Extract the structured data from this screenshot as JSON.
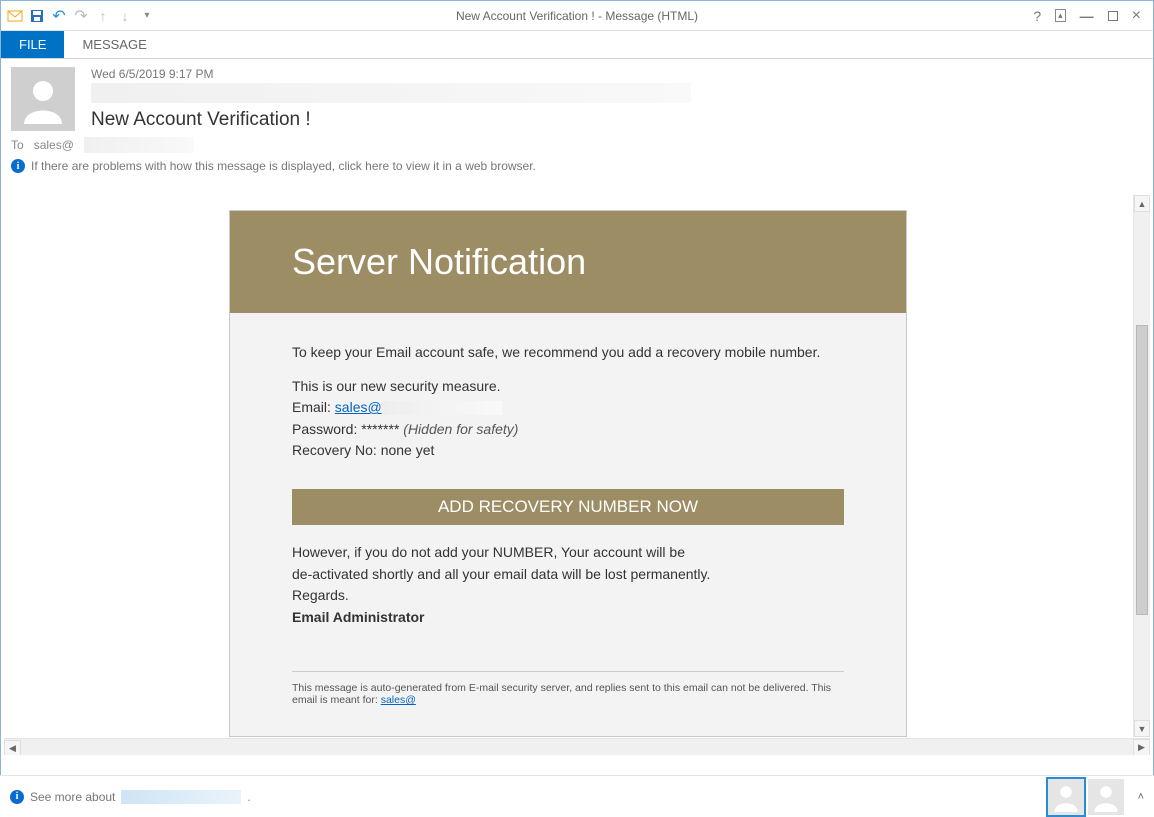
{
  "window": {
    "title": "New Account Verification ! - Message (HTML)"
  },
  "ribbon": {
    "file": "FILE",
    "message": "MESSAGE"
  },
  "header": {
    "date": "Wed 6/5/2019 9:17 PM",
    "subject": "New Account Verification !",
    "to_label": "To",
    "to_value": "sales@",
    "info_notice": "If there are problems with how this message is displayed, click here to view it in a web browser."
  },
  "email": {
    "banner": "Server Notification",
    "para1": "To keep your Email account safe, we recommend you add a recovery mobile number.",
    "para2": "This is our new security measure.",
    "email_label": "Email: ",
    "email_value": "sales@",
    "password_label": "Password: ",
    "password_mask": "*******",
    "password_hint": " (Hidden for safety)",
    "recovery_label": "Recovery No: ",
    "recovery_value": "none yet",
    "cta": "ADD RECOVERY NUMBER NOW",
    "warn1": "However, if you do not add your NUMBER, Your account will be",
    "warn2": "de-activated shortly and all your email data will be lost permanently.",
    "regards": "Regards.",
    "signature": "Email Administrator",
    "footer_text": "This message is auto-generated from E-mail security server, and replies sent to this email can not be delivered. This email is meant for: ",
    "footer_link": "sales@"
  },
  "footer": {
    "see_more": "See more about"
  }
}
